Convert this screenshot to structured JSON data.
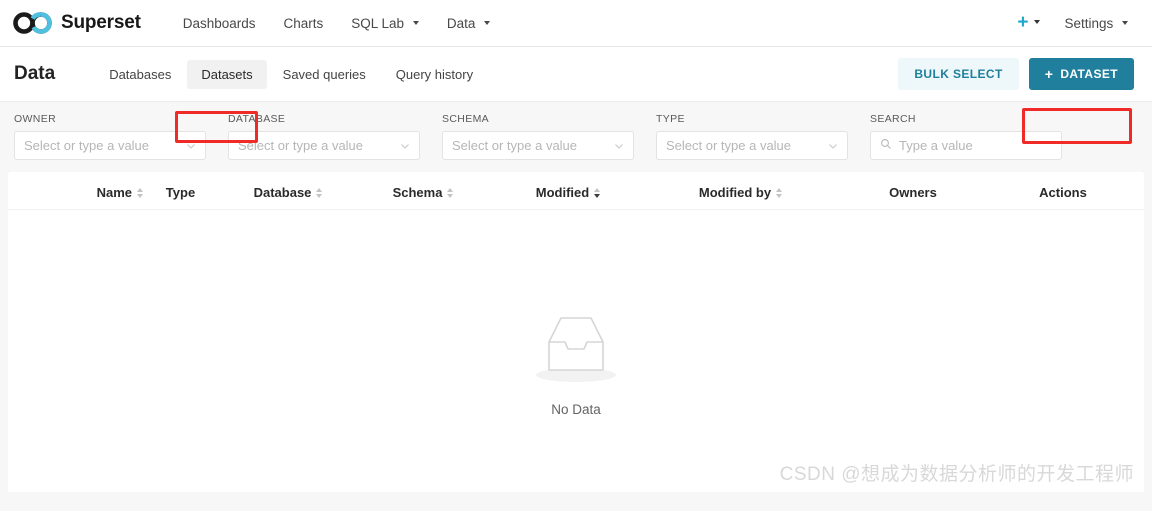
{
  "topnav": {
    "brand": "Superset",
    "links": [
      {
        "label": "Dashboards",
        "has_caret": false
      },
      {
        "label": "Charts",
        "has_caret": false
      },
      {
        "label": "SQL Lab",
        "has_caret": true
      },
      {
        "label": "Data",
        "has_caret": true
      }
    ],
    "plus_label": "+",
    "settings_label": "Settings"
  },
  "subheader": {
    "title": "Data",
    "tabs": [
      {
        "label": "Databases",
        "active": false
      },
      {
        "label": "Datasets",
        "active": true
      },
      {
        "label": "Saved queries",
        "active": false
      },
      {
        "label": "Query history",
        "active": false
      }
    ],
    "bulk_select_label": "BULK SELECT",
    "new_dataset_label": "DATASET",
    "new_dataset_plus": "+"
  },
  "filters": [
    {
      "label": "OWNER",
      "placeholder": "Select or type a value",
      "value": ""
    },
    {
      "label": "DATABASE",
      "placeholder": "Select or type a value",
      "value": ""
    },
    {
      "label": "SCHEMA",
      "placeholder": "Select or type a value",
      "value": ""
    },
    {
      "label": "TYPE",
      "placeholder": "Select or type a value",
      "value": ""
    }
  ],
  "search": {
    "label": "SEARCH",
    "placeholder": "Type a value",
    "value": ""
  },
  "table": {
    "columns": [
      {
        "label": "Name",
        "sortable": true,
        "sorted": false
      },
      {
        "label": "Type",
        "sortable": false,
        "sorted": false
      },
      {
        "label": "Database",
        "sortable": true,
        "sorted": false
      },
      {
        "label": "Schema",
        "sortable": true,
        "sorted": false
      },
      {
        "label": "Modified",
        "sortable": true,
        "sorted": true
      },
      {
        "label": "Modified by",
        "sortable": true,
        "sorted": false
      },
      {
        "label": "Owners",
        "sortable": false,
        "sorted": false
      },
      {
        "label": "Actions",
        "sortable": false,
        "sorted": false
      }
    ],
    "rows": [],
    "empty_text": "No Data"
  },
  "watermark": "CSDN @想成为数据分析师的开发工程师",
  "colors": {
    "accent_teal": "#1f7f9c",
    "accent_cyan": "#20a7c9",
    "annotation_red": "#f02a26",
    "page_bg": "#f7f7f7",
    "card_bg": "#ffffff"
  }
}
